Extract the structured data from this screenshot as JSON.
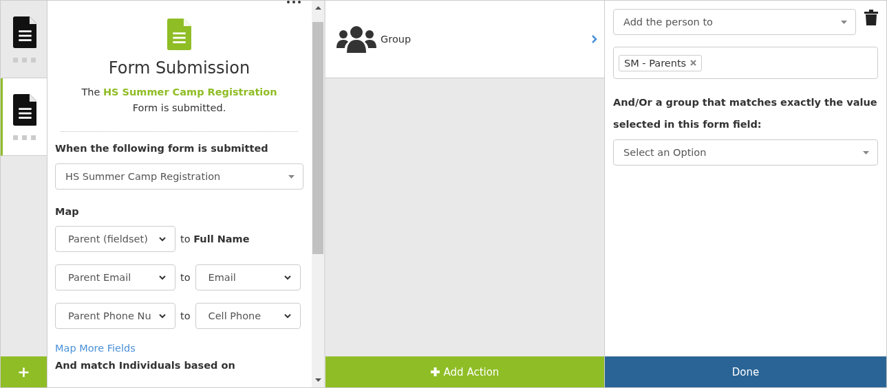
{
  "rail": {
    "items": [
      {
        "selected": false
      },
      {
        "selected": true
      }
    ],
    "add_button": "+"
  },
  "trigger": {
    "title": "Form Submission",
    "description": "The **HS Summer Camp Registration**",
    "description_line2": "Form is submitted.",
    "form_label": "When the following form is submitted",
    "form_select": "HS Summer Camp Registration",
    "map_label": "Map",
    "mappings": [
      {
        "kind": "fixed",
        "source": "Parent (fieldset)",
        "target": "to **Full Name**"
      },
      {
        "kind": "select",
        "source": "Parent Email",
        "connector": "to",
        "target": "Email"
      },
      {
        "kind": "select",
        "source": "Parent Phone Nu",
        "connector": "to",
        "target": "Cell Phone"
      }
    ],
    "more_link": "Map More Fields",
    "match_label": "And match Individuals based on"
  },
  "actions": {
    "items": [
      {
        "label": "Group"
      }
    ],
    "add_button": "Add Action"
  },
  "detail": {
    "add_select": "Add the person to",
    "tags": [
      "SM - Parents"
    ],
    "field_label": "And/Or a group that matches exactly the value selected in this form field:",
    "option_select": "Select an Option",
    "done_button": "Done"
  }
}
